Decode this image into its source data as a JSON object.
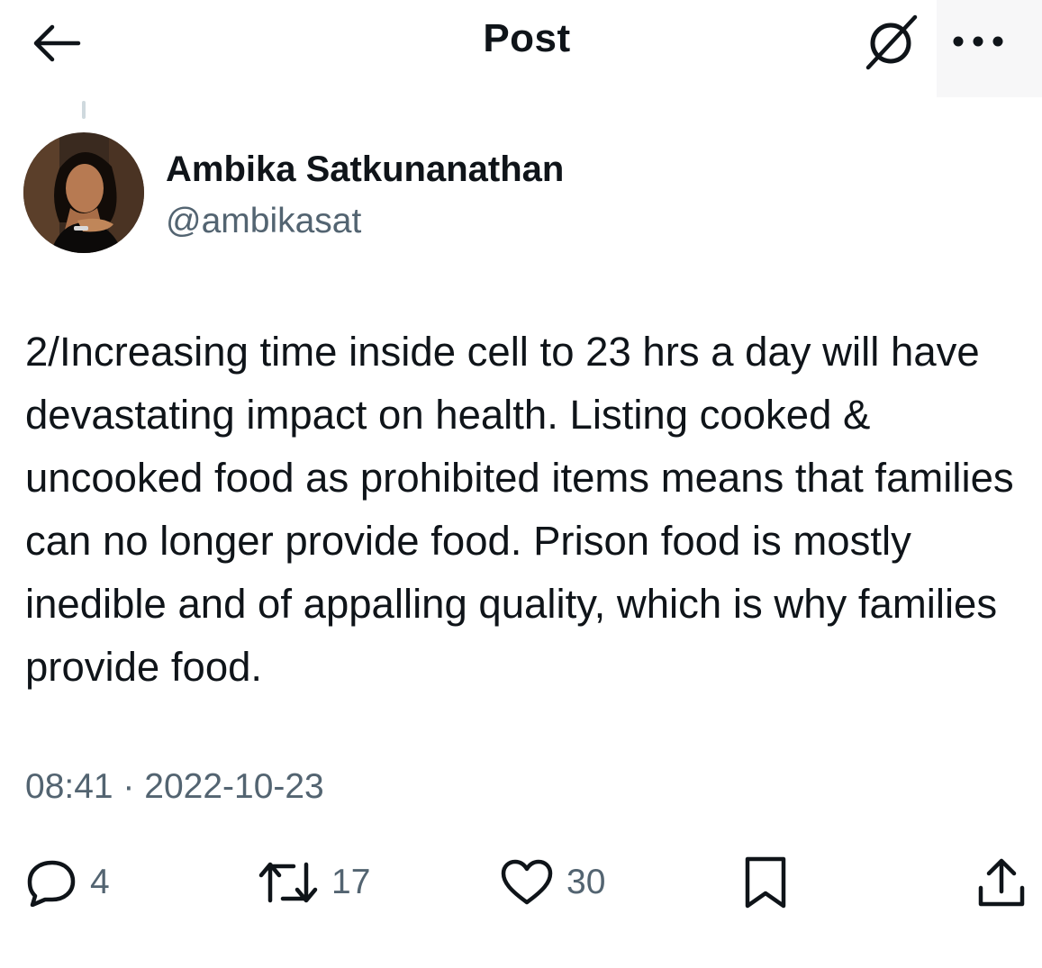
{
  "header": {
    "title": "Post",
    "back_icon": "arrow-left-icon",
    "grok_icon": "grok-slash-icon",
    "more_icon": "more-dots-icon"
  },
  "author": {
    "name": "Ambika Satkunanathan",
    "handle": "@ambikasat"
  },
  "post": {
    "text": "2/Increasing time inside cell to 23 hrs a day will have devastating impact on health. Listing cooked & uncooked food as prohibited items means that families can no longer provide food. Prison food is mostly inedible and of appalling quality, which is why families provide food.",
    "timestamp": "08:41 · 2022-10-23"
  },
  "actions": {
    "reply": {
      "icon": "reply-bubble-icon",
      "count": "4"
    },
    "repost": {
      "icon": "repost-icon",
      "count": "17"
    },
    "like": {
      "icon": "heart-icon",
      "count": "30"
    },
    "bookmark": {
      "icon": "bookmark-icon"
    },
    "share": {
      "icon": "share-icon"
    }
  },
  "colors": {
    "text": "#0f1419",
    "secondary": "#536471"
  }
}
